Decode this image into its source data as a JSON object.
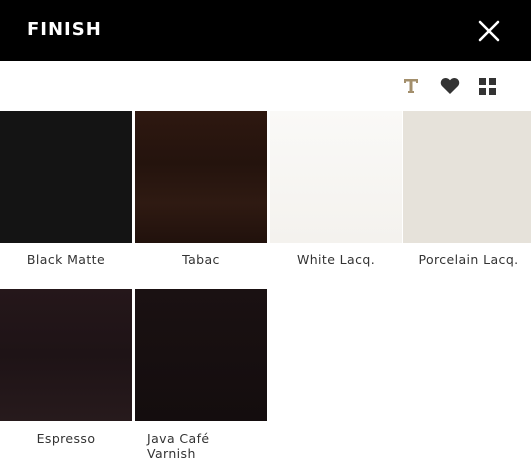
{
  "header": {
    "title": "FINISH",
    "close_icon": "close-icon",
    "background": "#000000"
  },
  "toolbar": {
    "icons": [
      "text-icon",
      "heart-icon",
      "grid-icon"
    ],
    "text_icon_color": "#a38f6c"
  },
  "finishes": [
    {
      "label": "Black Matte",
      "color": "#141414"
    },
    {
      "label": "Tabac",
      "color": "#2b1710"
    },
    {
      "label": "White Lacq.",
      "color": "#f5f3ef"
    },
    {
      "label": "Porcelain Lacq.",
      "color": "#e6e2da"
    },
    {
      "label": "Espresso",
      "color": "#22161a"
    },
    {
      "label": "Java Café\nVarnish",
      "label_line1": "Java Café",
      "label_line2": "Varnish",
      "color": "#170f10"
    }
  ]
}
